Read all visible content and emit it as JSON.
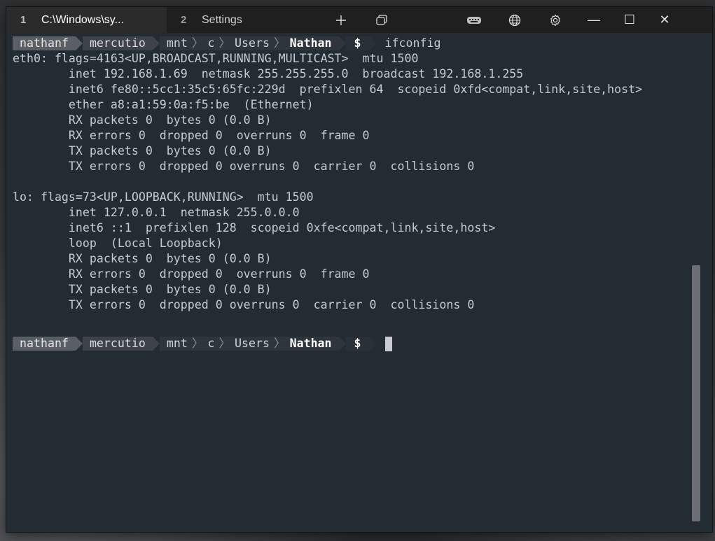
{
  "tabs": [
    {
      "number": "1",
      "title": "C:\\Windows\\sy..."
    },
    {
      "number": "2",
      "title": "Settings"
    }
  ],
  "toolbar": {
    "new_tab_icon": "plus-icon",
    "duplicate_icon": "window-copy-icon",
    "keyboard_icon": "keyboard-icon",
    "globe_icon": "globe-icon",
    "settings_icon": "gear-icon",
    "minimize": "—",
    "maximize": "☐",
    "close": "✕"
  },
  "prompt": {
    "user": "nathanf",
    "host": "mercutio",
    "path": [
      "mnt",
      "c",
      "Users"
    ],
    "cwd": "Nathan",
    "symbol": "$"
  },
  "command": "ifconfig",
  "output": [
    "eth0: flags=4163<UP,BROADCAST,RUNNING,MULTICAST>  mtu 1500",
    "        inet 192.168.1.69  netmask 255.255.255.0  broadcast 192.168.1.255",
    "        inet6 fe80::5cc1:35c5:65fc:229d  prefixlen 64  scopeid 0xfd<compat,link,site,host>",
    "        ether a8:a1:59:0a:f5:be  (Ethernet)",
    "        RX packets 0  bytes 0 (0.0 B)",
    "        RX errors 0  dropped 0  overruns 0  frame 0",
    "        TX packets 0  bytes 0 (0.0 B)",
    "        TX errors 0  dropped 0 overruns 0  carrier 0  collisions 0",
    "",
    "lo: flags=73<UP,LOOPBACK,RUNNING>  mtu 1500",
    "        inet 127.0.0.1  netmask 255.0.0.0",
    "        inet6 ::1  prefixlen 128  scopeid 0xfe<compat,link,site,host>",
    "        loop  (Local Loopback)",
    "        RX packets 0  bytes 0 (0.0 B)",
    "        RX errors 0  dropped 0  overruns 0  frame 0",
    "        TX packets 0  bytes 0 (0.0 B)",
    "        TX errors 0  dropped 0 overruns 0  carrier 0  collisions 0",
    ""
  ],
  "colors": {
    "terminal_bg": "#232b33",
    "foreground": "#c5ccd3",
    "titlebar_bg": "#1f1f1f"
  }
}
